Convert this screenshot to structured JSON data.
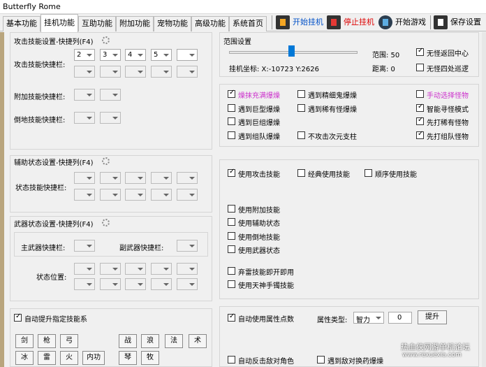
{
  "window": {
    "title": "Butterfly Rome"
  },
  "tabs": [
    "基本功能",
    "挂机功能",
    "互助功能",
    "附加功能",
    "宠物功能",
    "高级功能",
    "系统首页"
  ],
  "toolbar": {
    "start": "开始挂机",
    "stop": "停止挂机",
    "start_game": "开始游戏",
    "save": "保存设置"
  },
  "attack": {
    "title": "攻击技能设置-快捷列(F4)",
    "row_label": "攻击技能快捷栏:",
    "slots_row1": [
      "2",
      "3",
      "4",
      "5",
      ""
    ],
    "append_label": "附加技能快捷栏:",
    "ground_label": "倒地技能快捷栏:"
  },
  "support": {
    "title": "辅助状态设置-快捷列(F4)",
    "row_label": "状态技能快捷栏:"
  },
  "weapon": {
    "title": "武器状态设置-快捷列(F4)",
    "main_label": "主武器快捷栏:",
    "sub_label": "副武器快捷栏:",
    "pos_label": "状态位置:"
  },
  "auto_skill": {
    "label": "自动提升指定技能系",
    "row1": [
      "剑",
      "枪",
      "弓",
      "",
      "战",
      "浪",
      "法",
      "术"
    ],
    "row2": [
      "冰",
      "雷",
      "火",
      "内功",
      "",
      "琴",
      "牧",
      ""
    ]
  },
  "range": {
    "title": "范围设置",
    "coord_label": "挂机坐标: X:-10723 Y:2626",
    "range_label": "范围: 50",
    "dist_label": "距离: 0",
    "opt_center": "无怪返回中心",
    "opt_patrol": "无怪四处巡逻"
  },
  "monsters": {
    "opt1": "燥抹充满爆燥",
    "opt2": "遇到精细鬼爆燥",
    "opt3": "手动选择怪物",
    "opt4": "遇到巨型爆燥",
    "opt5": "遇到稀有怪爆燥",
    "opt6": "智能寻怪模式",
    "opt7": "遇到巨组爆燥",
    "opt8": "先打稀有怪物",
    "opt9": "遇到组队爆燥",
    "opt10": "不攻击次元支柱",
    "opt11": "先打组队怪物",
    "colors": {
      "magenta": "#cc33cc"
    }
  },
  "skills": {
    "use_attack": "使用攻击技能",
    "classic": "经典使用技能",
    "order": "顺序使用技能",
    "use_append": "使用附加技能",
    "use_support": "使用辅助状态",
    "use_ground": "使用倒地技能",
    "use_weapon": "使用武器状态",
    "abandon": "弃雷技能即开即用",
    "heaven": "使用天神手镯技能"
  },
  "attr": {
    "auto_points": "自动使用属性点数",
    "type_label": "属性类型:",
    "type_value": "智力",
    "points_value": "0",
    "upgrade": "提升",
    "counter": "自动反击敌对角色",
    "enemy": "遇到敌对换药爆燥"
  },
  "watermark": {
    "line1": "热血侠网游单机论坛",
    "line2": "www.rexuexia.com"
  }
}
